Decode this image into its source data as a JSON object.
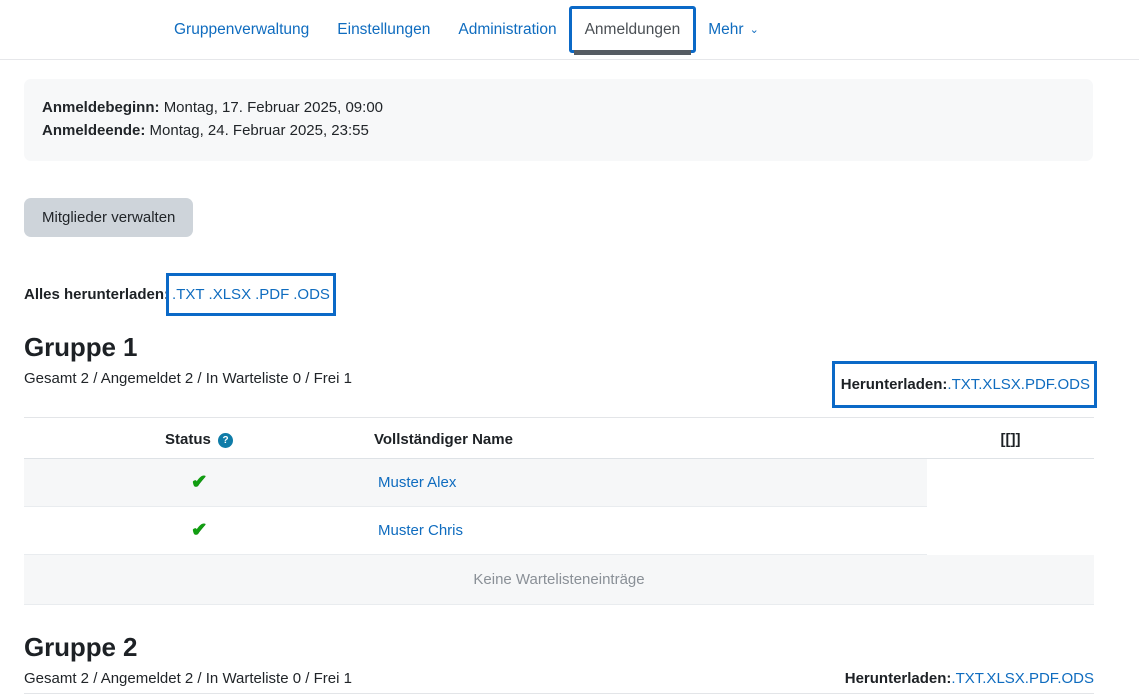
{
  "nav": {
    "items": [
      {
        "label": "Gruppenverwaltung",
        "state": "link"
      },
      {
        "label": "Einstellungen",
        "state": "link"
      },
      {
        "label": "Administration",
        "state": "link"
      },
      {
        "label": "Anmeldungen",
        "state": "active-focused"
      },
      {
        "label": "Mehr",
        "state": "dropdown",
        "caret": "⌄"
      }
    ]
  },
  "infobox": {
    "start_label": "Anmeldebeginn:",
    "start_value": "Montag, 17. Februar 2025, 09:00",
    "end_label": "Anmeldeende:",
    "end_value": "Montag, 24. Februar 2025, 23:55"
  },
  "actions": {
    "manage_members_label": "Mitglieder verwalten"
  },
  "download_all": {
    "label": "Alles herunterladen:",
    "formats": [
      ".TXT",
      ".XLSX",
      ".PDF",
      ".ODS"
    ]
  },
  "table_headers": {
    "status": "Status",
    "status_help_icon": "help-question-icon",
    "full_name": "Vollständiger Name",
    "extra": "[[]]"
  },
  "waitlist_empty_text": "Keine Wartelisteneinträge",
  "group_download": {
    "label": "Herunterladen:",
    "formats": [
      ".TXT",
      ".XLSX",
      ".PDF",
      ".ODS"
    ]
  },
  "groups": [
    {
      "title": "Gruppe 1",
      "meta": "Gesamt 2 / Angemeldet 2 / In Warteliste 0 / Frei 1",
      "download_boxed": true,
      "members": [
        {
          "status": "✔",
          "name": "Muster Alex"
        },
        {
          "status": "✔",
          "name": "Muster Chris"
        }
      ]
    },
    {
      "title": "Gruppe 2",
      "meta": "Gesamt 2 / Angemeldet 2 / In Warteliste 0 / Frei 1",
      "download_boxed": false,
      "members": []
    }
  ],
  "colors": {
    "link": "#0f6cbf",
    "focus_outline": "#0b69c7",
    "active_tab_underline": "#555c63",
    "help_icon": "#0f7ca8",
    "check_green": "#119e11",
    "button_bg": "#ced4da",
    "infobox_bg": "#f7f8f9"
  }
}
